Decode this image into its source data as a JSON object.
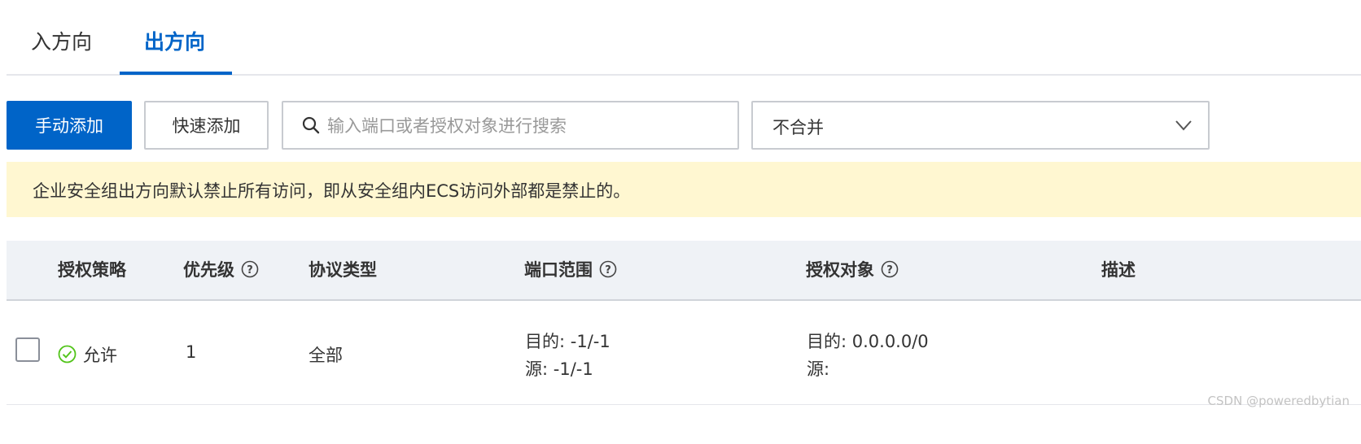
{
  "tabs": {
    "inbound": "入方向",
    "outbound": "出方向"
  },
  "toolbar": {
    "manual_add": "手动添加",
    "quick_add": "快速添加",
    "search_placeholder": "输入端口或者授权对象进行搜索",
    "merge_select_value": "不合并"
  },
  "notice": {
    "text": "企业安全组出方向默认禁止所有访问，即从安全组内ECS访问外部都是禁止的。"
  },
  "table": {
    "headers": {
      "policy": "授权策略",
      "priority": "优先级",
      "protocol": "协议类型",
      "port_range": "端口范围",
      "auth_object": "授权对象",
      "description": "描述"
    },
    "rows": [
      {
        "policy": "允许",
        "priority": "1",
        "protocol": "全部",
        "port_dest": "目的: -1/-1",
        "port_src": "源: -1/-1",
        "auth_dest": "目的: 0.0.0.0/0",
        "auth_src": "源:",
        "description": ""
      }
    ]
  },
  "watermark": "CSDN @poweredbytian",
  "colors": {
    "primary": "#0064c8",
    "notice_bg": "#fff7d1",
    "allow": "#52c41a"
  }
}
